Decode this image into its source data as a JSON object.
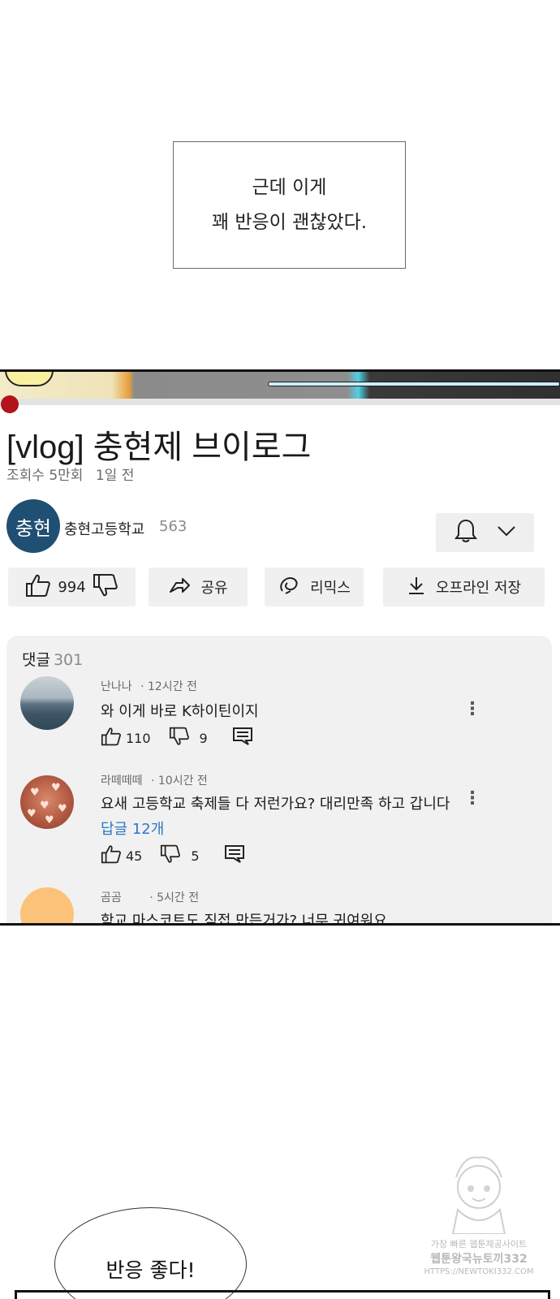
{
  "caption": {
    "line1": "근데 이게",
    "line2": "꽤 반응이 괜찮았다."
  },
  "video": {
    "title": "[vlog] 충현제 브이로그",
    "views": "조회수 5만회",
    "age": "1일 전",
    "progress_fraction": 0.0
  },
  "channel": {
    "avatar_text": "충현",
    "name": "충현고등학교",
    "subscribers": "563"
  },
  "actions": {
    "likes": "994",
    "share": "공유",
    "remix": "리믹스",
    "offline": "오프라인 저장"
  },
  "comments": {
    "label": "댓글",
    "count": "301",
    "items": [
      {
        "author": "난나나",
        "time": "· 12시간 전",
        "text": "와 이게 바로 K하이틴이지",
        "likes": "110",
        "dislikes": "9",
        "replies": ""
      },
      {
        "author": "라떼떼떼",
        "time": "· 10시간 전",
        "text": "요새 고등학교 축제들 다 저런가요? 대리만족 하고 갑니다",
        "likes": "45",
        "dislikes": "5",
        "replies": "답글 12개"
      },
      {
        "author": "곰곰",
        "time": "· 5시간 전",
        "text": "학교 마스코트도 직접 만든거가? 너무 귀여워요"
      }
    ]
  },
  "speech": {
    "text": "반응 좋다!"
  },
  "watermark": {
    "line1": "가장 빠른 웹툰제공사이트",
    "line2": "웹툰왕국뉴토끼332",
    "line3": "HTTPS://NEWTOKI332.COM"
  }
}
